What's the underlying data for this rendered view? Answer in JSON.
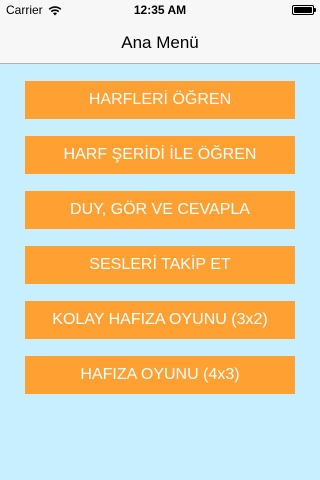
{
  "status_bar": {
    "carrier": "Carrier",
    "time": "12:35 AM"
  },
  "nav": {
    "title": "Ana Menü"
  },
  "menu": [
    {
      "label": "HARFLERİ ÖĞREN"
    },
    {
      "label": "HARF ŞERİDİ İLE ÖĞREN"
    },
    {
      "label": "DUY, GÖR VE CEVAPLA"
    },
    {
      "label": "SESLERİ TAKİP ET"
    },
    {
      "label": "KOLAY HAFIZA OYUNU (3x2)"
    },
    {
      "label": "HAFIZA OYUNU (4x3)"
    }
  ],
  "colors": {
    "background": "#c8efff",
    "button": "#ffa033",
    "button_text": "#ffffff"
  }
}
